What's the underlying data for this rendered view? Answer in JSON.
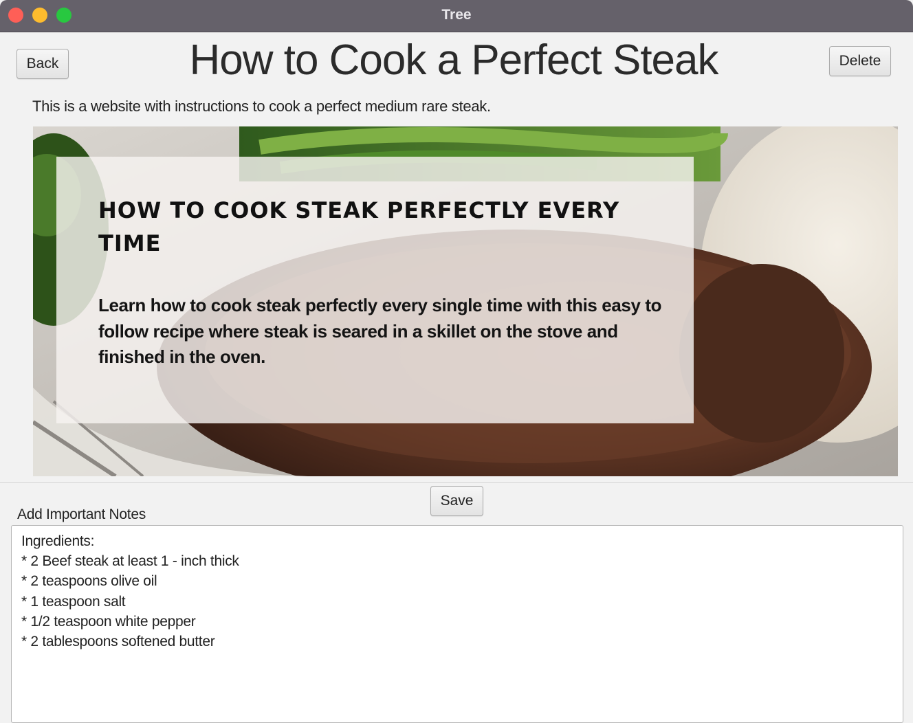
{
  "window": {
    "title": "Tree"
  },
  "header": {
    "back_label": "Back",
    "page_title": "How to Cook a Perfect Steak",
    "delete_label": "Delete",
    "description": "This is a website with instructions to cook a perfect medium rare steak."
  },
  "web_view": {
    "heading": "HOW TO COOK STEAK PERFECTLY EVERY TIME",
    "body": "Learn how to cook steak perfectly every single time with this easy to follow recipe where steak is seared in a skillet on the stove and finished in the oven."
  },
  "notes": {
    "save_label": "Save",
    "label": "Add Important Notes",
    "lines": [
      "Ingredients:",
      "* 2 Beef steak at least 1 - inch thick",
      "* 2 teaspoons olive oil",
      "* 1 teaspoon salt",
      "* 1/2 teaspoon white pepper",
      "* 2 tablespoons softened butter"
    ]
  },
  "colors": {
    "titlebar": "#65616a",
    "close": "#fe5f57",
    "minimize": "#febc2e",
    "maximize": "#28c840"
  }
}
